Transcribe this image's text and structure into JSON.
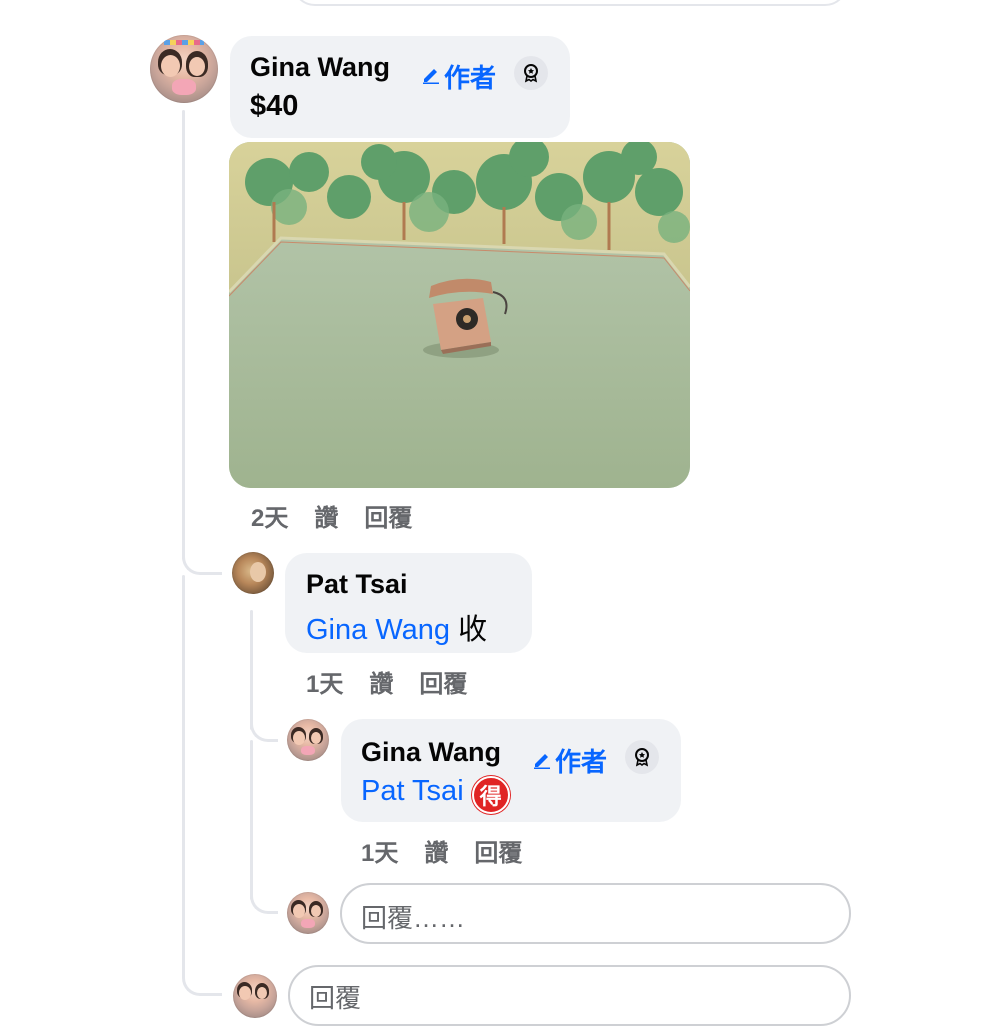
{
  "colors": {
    "link": "#0866ff",
    "bubble": "#f0f2f5",
    "meta": "#65676b",
    "line": "#e4e6eb"
  },
  "comment1": {
    "author": "Gina Wang",
    "author_badge": "作者",
    "badge_icon": "top-fan-badge-icon",
    "text": "$40",
    "time": "2天",
    "like": "讚",
    "reply": "回覆"
  },
  "reply1": {
    "author": "Pat Tsai",
    "mention": "Gina Wang",
    "text": "收",
    "time": "1天",
    "like": "讚",
    "reply": "回覆"
  },
  "reply2": {
    "author": "Gina Wang",
    "author_badge": "作者",
    "badge_icon": "top-fan-badge-icon",
    "mention": "Pat Tsai",
    "emoji": "得",
    "time": "1天",
    "like": "讚",
    "reply": "回覆"
  },
  "reply_box_nested": {
    "placeholder": "回覆……"
  },
  "reply_box_top": {
    "placeholder": "回覆"
  }
}
